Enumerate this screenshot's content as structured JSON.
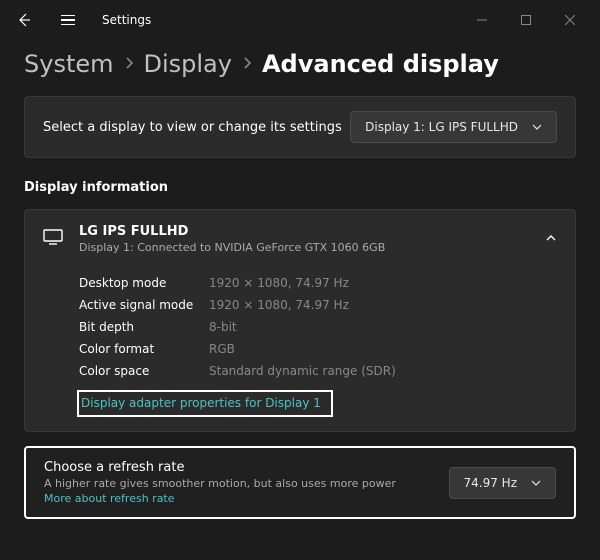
{
  "window": {
    "title": "Settings"
  },
  "breadcrumb": {
    "system": "System",
    "display": "Display",
    "current": "Advanced display"
  },
  "select_display": {
    "label": "Select a display to view or change its settings",
    "dropdown_value": "Display 1: LG IPS FULLHD"
  },
  "section_display_info": "Display information",
  "display_card": {
    "name": "LG IPS FULLHD",
    "sub": "Display 1: Connected to NVIDIA GeForce GTX 1060 6GB",
    "rows": [
      {
        "label": "Desktop mode",
        "value": "1920 × 1080, 74.97 Hz"
      },
      {
        "label": "Active signal mode",
        "value": "1920 × 1080, 74.97 Hz"
      },
      {
        "label": "Bit depth",
        "value": "8-bit"
      },
      {
        "label": "Color format",
        "value": "RGB"
      },
      {
        "label": "Color space",
        "value": "Standard dynamic range (SDR)"
      }
    ],
    "adapter_link": "Display adapter properties for Display 1"
  },
  "refresh": {
    "title": "Choose a refresh rate",
    "desc": "A higher rate gives smoother motion, but also uses more power",
    "link": "More about refresh rate",
    "dropdown_value": "74.97 Hz"
  }
}
